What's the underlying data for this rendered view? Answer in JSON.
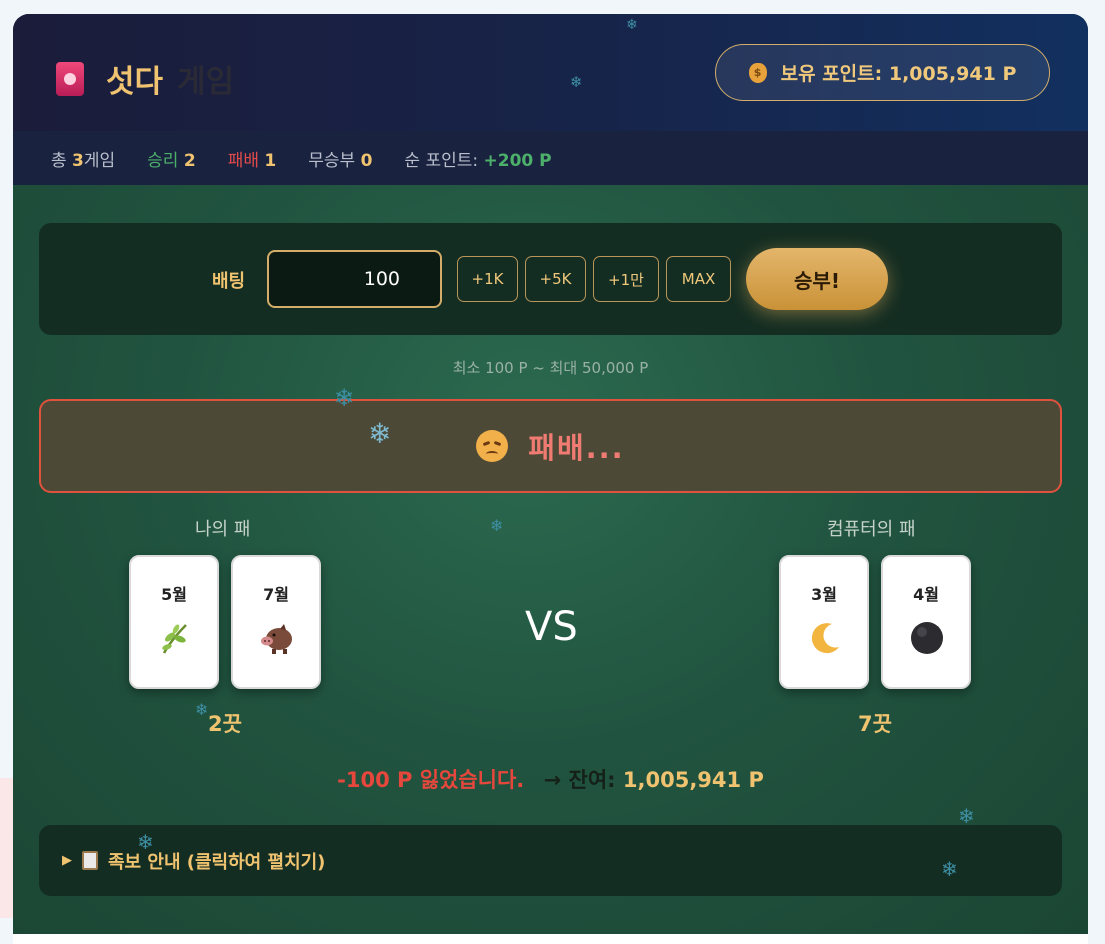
{
  "header": {
    "title": "섯다",
    "subtitle": "게임",
    "points_label": "보유 포인트: 1,005,941 P",
    "icon": "flower-card-icon",
    "points_icon": "money-bag-icon"
  },
  "stats": {
    "total_prefix": "총",
    "total_value": "3",
    "total_suffix": "게임",
    "win_label": "승리",
    "win_value": "2",
    "lose_label": "패배",
    "lose_value": "1",
    "draw_label": "무승부",
    "draw_value": "0",
    "net_label": "순 포인트:",
    "net_value": "+200 P"
  },
  "bet": {
    "label": "배팅",
    "value": "100",
    "chips": [
      "+1K",
      "+5K",
      "+1만",
      "MAX"
    ],
    "go_label": "승부!",
    "range_note": "최소 100 P ~ 최대 50,000 P"
  },
  "result": {
    "text": "패배...",
    "icon": "sad-face-icon"
  },
  "player": {
    "label": "나의 패",
    "cards": [
      {
        "month": "5월",
        "icon": "iris-leaf-icon"
      },
      {
        "month": "7월",
        "icon": "boar-icon"
      }
    ],
    "score": "2끗"
  },
  "computer": {
    "label": "컴퓨터의 패",
    "cards": [
      {
        "month": "3월",
        "icon": "crescent-moon-icon"
      },
      {
        "month": "4월",
        "icon": "black-circle-icon"
      }
    ],
    "score": "7끗"
  },
  "vs": "VS",
  "outcome": {
    "loss": "-100 P 잃었습니다.",
    "arrow": "→",
    "balance_label": "잔여:",
    "balance_value": "1,005,941 P"
  },
  "guide": {
    "label": "족보 안내 (클릭하여 펼치기)"
  },
  "colors": {
    "gold": "#efc36f",
    "win": "#4caf6a",
    "lose": "#e34b4b",
    "table_green": "#215440",
    "header_navy": "#17244a"
  }
}
